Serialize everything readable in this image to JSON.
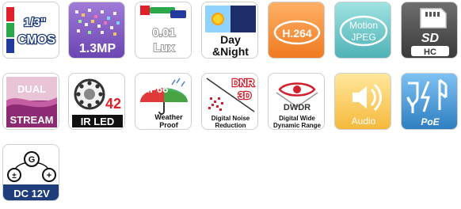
{
  "badges": {
    "sensor": {
      "size": "1/3\"",
      "type": "CMOS"
    },
    "megapixel": {
      "label": "1.3MP"
    },
    "lux": {
      "value": "0.01",
      "unit": "Lux"
    },
    "day_night": {
      "line1": "Day",
      "line2": "&Night"
    },
    "codec": {
      "label": "H.264"
    },
    "motion_jpeg": {
      "line1": "Motion",
      "line2": "JPEG"
    },
    "sd": {
      "sd": "SD",
      "hc": "HC"
    },
    "dual_stream": {
      "line1": "DUAL",
      "line2": "STREAM"
    },
    "ir_led": {
      "count": "42",
      "label": "IR LED"
    },
    "ip66": {
      "rating": "IP66",
      "line1": "Weather",
      "line2": "Proof"
    },
    "dnr": {
      "line1": "DNR",
      "line2": "3D",
      "caption1": "Digital Noise",
      "caption2": "Reduction"
    },
    "dwdr": {
      "label": "DWDR",
      "caption1": "Digital Wide",
      "caption2": "Dynamic Range"
    },
    "audio": {
      "label": "Audio"
    },
    "poe": {
      "label": "PoE"
    },
    "dc": {
      "ground": "G",
      "minus": "±",
      "plus": "+",
      "label": "DC 12V"
    }
  },
  "colors": {
    "brand_red": "#e0202a",
    "dnr_red": "#d21f2d",
    "dark": "#222222",
    "purple": "#6b45b2",
    "orange": "#f07a21",
    "teal": "#4fb3b7",
    "yellow": "#f6b93b",
    "blue": "#2f7fc2",
    "navy": "#1f3d7a"
  }
}
